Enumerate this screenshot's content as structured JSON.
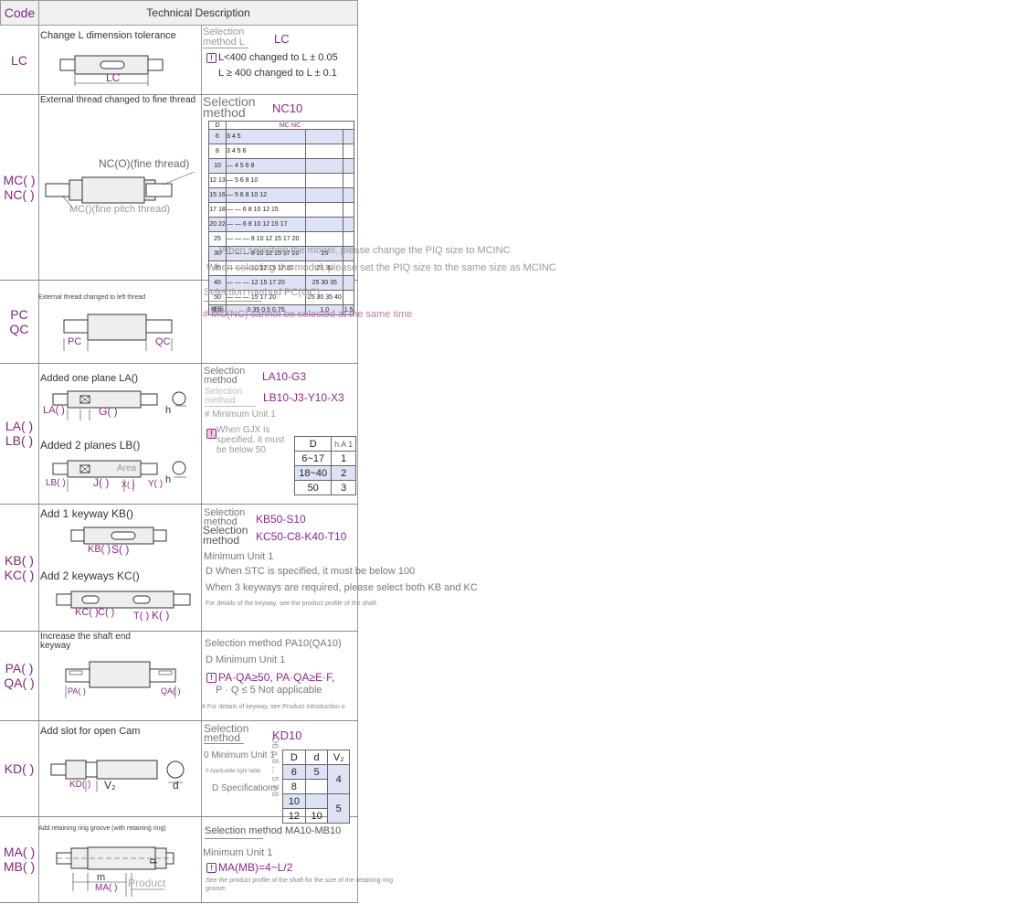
{
  "header": {
    "code": "Code",
    "desc": "Technical Description"
  },
  "rows": {
    "lc": {
      "code": [
        "LC"
      ],
      "title": "Change L dimension tolerance",
      "fig_label": "LC",
      "sel_label": "Selection\nmethod L",
      "sel_value": "LC",
      "notes": [
        "L<400 changed to L ± 0.05",
        "L ≥ 400 changed to L ± 0.1"
      ]
    },
    "mc": {
      "code": [
        "MC( )",
        "NC( )"
      ],
      "title": "External thread changed to fine thread",
      "fig_label_top": "NC(O)(fine thread)",
      "fig_label_bottom": "MC()(fine pitch thread)",
      "sel_label": "Selection\nmethod",
      "sel_value": "NC10",
      "table_head": [
        "D",
        "MC·NC"
      ],
      "table_rows": [
        [
          "6",
          "3 4 5",
          "",
          ""
        ],
        [
          "8",
          "3 4 5 6",
          "",
          ""
        ],
        [
          "10",
          "— 4 5 6 8",
          "",
          ""
        ],
        [
          "12 13",
          "— 5 6 8 10",
          "",
          ""
        ],
        [
          "15 16",
          "— 5 6 8 10 12",
          "",
          ""
        ],
        [
          "17 18",
          "— — 6 8 10 12 15",
          "",
          ""
        ],
        [
          "20 22",
          "— — 6 8 10 12 15 17",
          "",
          ""
        ],
        [
          "25",
          "— — — 8 10 12 15 17 20",
          "",
          ""
        ],
        [
          "30",
          "— — — 8 10 12 15 17 20",
          "25",
          ""
        ],
        [
          "35",
          "— — — 10 12 15 17 20",
          "25 30",
          ""
        ],
        [
          "40",
          "— — — 12 15 17 20",
          "25 30 35",
          ""
        ],
        [
          "50",
          "— — — 15 17 20",
          "25 30 35 40",
          ""
        ],
        [
          "螺距",
          "0.35 0.5 0.75",
          "1.0",
          "1.5"
        ]
      ],
      "notes": [
        "When selecting the model, please change the PIQ size to MCINC",
        "When selecting the model, please set the PIQ size to the same size as MCINC"
      ]
    },
    "pc": {
      "code": [
        "PC",
        "QC"
      ],
      "title": "External thread changed to left thread",
      "fig_labels": [
        "PC",
        "QC"
      ],
      "sel": "Selection method PC(QC)",
      "note": "# MC(NC) cannot be selected at the same time"
    },
    "la": {
      "code": [
        "LA( )",
        "LB( )"
      ],
      "title1": "Added one plane LA()",
      "fig1_labels": [
        "LA( )",
        "G( )",
        "h"
      ],
      "title2": "Added 2 planes LB()",
      "fig2_labels": [
        "LB( )",
        "J( )",
        "X( )",
        "Y( )",
        "h",
        "Area"
      ],
      "sel1_label": "Selection\nmethod",
      "sel1_value": "LA10-G3",
      "sel2_label": "Selection\nmethod",
      "sel2_value": "LB10-J3-Y10-X3",
      "min_unit": "# Minimum Unit 1",
      "warn": "When GJX is specified, it must be below 50",
      "table_head": [
        "D",
        "h A 1"
      ],
      "table_rows": [
        [
          "6~17",
          "1"
        ],
        [
          "18~40",
          "2"
        ],
        [
          "50",
          "3"
        ]
      ]
    },
    "kb": {
      "code": [
        "KB( )",
        "KC( )"
      ],
      "title1": "Add 1 keyway KB()",
      "fig1_labels": [
        "KB( )",
        "S( )"
      ],
      "title2": "Add 2 keyways KC()",
      "fig2_labels": [
        "KC( )",
        "C( )",
        "T( )",
        "K( )"
      ],
      "sel1_label": "Selection\nmethod",
      "sel1_value": "KB50-S10",
      "sel2_label": "Selection\nmethod",
      "sel2_value": "KC50-C8-K40-T10",
      "notes": [
        "Minimum Unit 1",
        "D When STC is specified, it must be below 100",
        "When 3 keyways are required, please select both KB and KC"
      ],
      "small": "For details of the keyway, see the product profile of the shaft."
    },
    "pa": {
      "code": [
        "PA( )",
        "QA( )"
      ],
      "title": "Increase the shaft end keyway",
      "fig_labels": [
        "PA( )",
        "QA( )"
      ],
      "sel": "Selection method PA10(QA10)",
      "min_unit": "D Minimum Unit 1",
      "warn": "PA·QA≥50, PA·QA≥E·F,",
      "not_applicable": "P · Q ≤ 5 Not applicable",
      "small": "# For details of keyway, see Product Introduction o"
    },
    "kd": {
      "code": [
        "KD( )"
      ],
      "title": "Add slot for open Cam",
      "fig_labels": [
        "KD( )",
        "V₂",
        "d"
      ],
      "sel_label": "Selection\nmethod",
      "sel_value": "KD10",
      "min_unit": "0 Minimum Unit 1",
      "applicable": "0 Applicable right table",
      "spec": "D Specifications",
      "table_head": [
        "D",
        "d",
        "V₂"
      ],
      "table_rows": [
        [
          "6",
          "5",
          "4"
        ],
        [
          "8",
          "",
          ""
        ],
        [
          "10",
          "",
          "5"
        ],
        [
          "12",
          "10",
          ""
        ]
      ],
      "side_text": "D6 a 8 ... 5 7 8"
    },
    "ma": {
      "code": [
        "MA( )",
        "MB( )"
      ],
      "title": "Add retaining ring groove (with retaining ring)",
      "fig_labels": [
        "m",
        "MA( )",
        "d",
        "Product"
      ],
      "sel": "Selection method MA10-MB10",
      "min_unit": "Minimum Unit 1",
      "warn": "MA(MB)=4~L/2",
      "small": "See the product profile of the shaft for the size of the retaining ring groove."
    }
  },
  "colors": {
    "accent": "#8a2a8a",
    "grey": "#999999",
    "table_blue": "#dde3f4"
  }
}
